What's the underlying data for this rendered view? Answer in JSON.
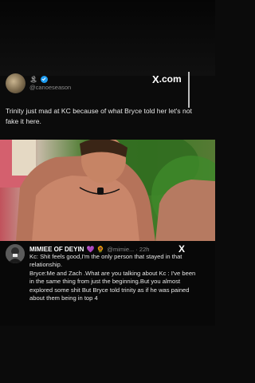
{
  "tweet1": {
    "name_icons": "🏝 ",
    "handle": "@canoeseason",
    "x_logo_glyph": "X",
    "x_logo_domain": ".com",
    "text": "Trinity just mad at KC because of what Bryce told her let's not fake it here."
  },
  "video_frame": {
    "description_icon": "person-photo"
  },
  "tweet2": {
    "name": "MIMIEE OF DEYIN",
    "emoji_heart": "💜",
    "emoji_sun": "🌻",
    "handle": "@mimie... · 22h",
    "x_logo_glyph": "X",
    "text": "Kc: Shit feels good,I'm the only person that stayed in that relationship.\nBryce:Me and Zach .What are you talking about Kc : I've been in the same thing from just the beginning.But you almost explored some shit But Bryce told trinity as if he was pained about them being in top 4"
  },
  "colors": {
    "background": "#0b0b0b",
    "verified_blue": "#1d9bf0",
    "text": "#e8e8e8",
    "muted": "#8a8a8a"
  }
}
